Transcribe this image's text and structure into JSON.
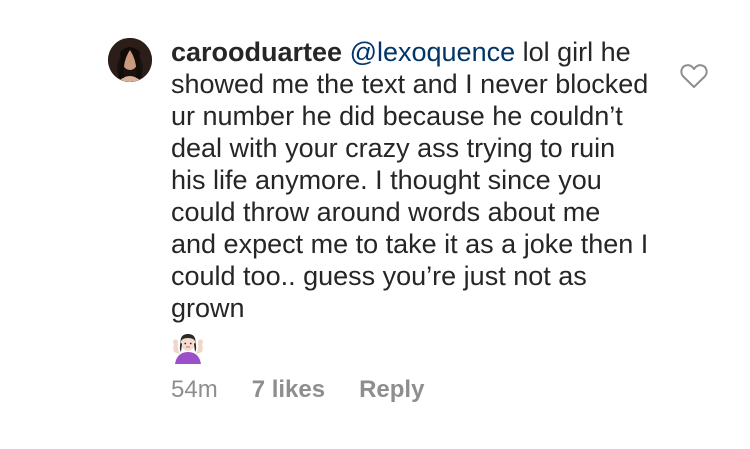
{
  "comment": {
    "username": "carooduartee",
    "mention": "@lexoquence",
    "text": " lol girl he showed me the text and I never blocked ur number he did because he couldn’t deal with your crazy ass trying to ruin his life anymore. I thought since you could throw around words about me and expect me to take it as a joke then I could too.. guess you’re just not as grown",
    "emoji": "shrugging-woman-emoji",
    "timestamp": "54m",
    "likes": "7 likes",
    "reply_label": "Reply",
    "like_icon": "heart-outline-icon"
  },
  "colors": {
    "text": "#262626",
    "mention": "#003569",
    "meta": "#8e8e8e",
    "like_icon_stroke": "#8e8e8e"
  }
}
